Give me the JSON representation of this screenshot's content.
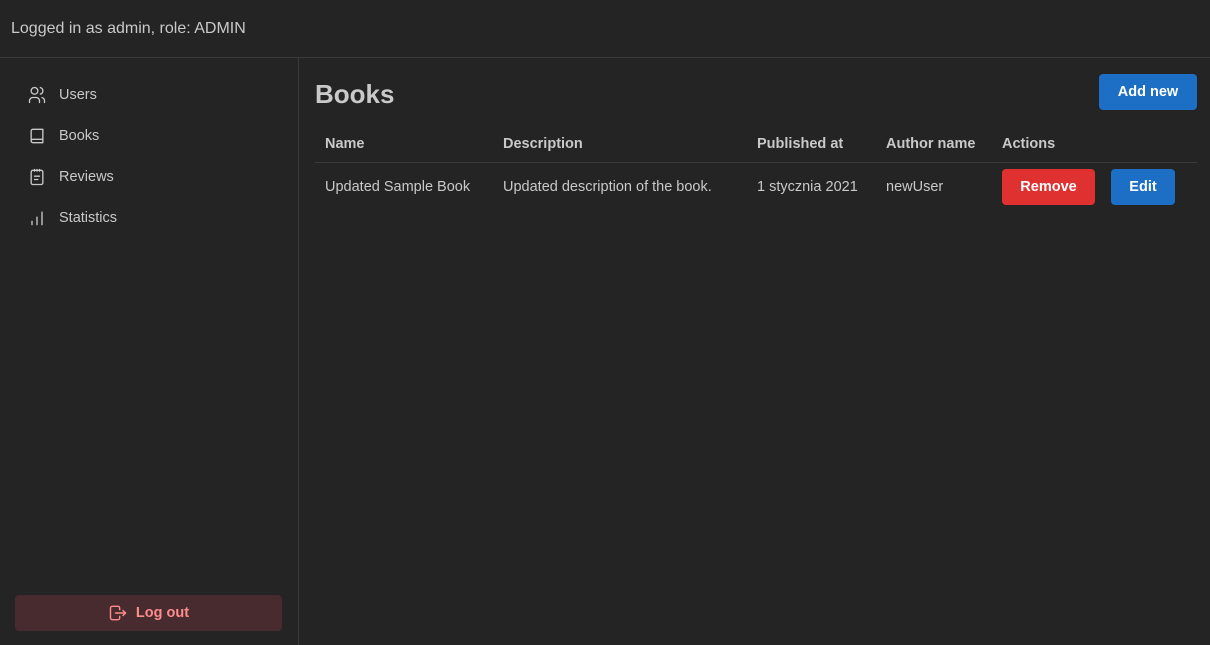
{
  "header": {
    "login_text": "Logged in as admin, role: ADMIN"
  },
  "sidebar": {
    "items": [
      {
        "label": "Users",
        "icon": "users-icon"
      },
      {
        "label": "Books",
        "icon": "book-icon"
      },
      {
        "label": "Reviews",
        "icon": "clipboard-icon"
      },
      {
        "label": "Statistics",
        "icon": "chart-bar-icon"
      }
    ],
    "logout_label": "Log out"
  },
  "main": {
    "title": "Books",
    "add_button_label": "Add new",
    "table": {
      "columns": [
        "Name",
        "Description",
        "Published at",
        "Author name",
        "Actions"
      ],
      "rows": [
        {
          "name": "Updated Sample Book",
          "description": "Updated description of the book.",
          "published_at": "1 stycznia 2021",
          "author_name": "newUser",
          "remove_label": "Remove",
          "edit_label": "Edit"
        }
      ]
    }
  },
  "colors": {
    "background": "#242424",
    "primary": "#1c6fc4",
    "danger": "#e03131",
    "logout_bg": "#472b2e",
    "logout_text": "#ff8c8c"
  }
}
